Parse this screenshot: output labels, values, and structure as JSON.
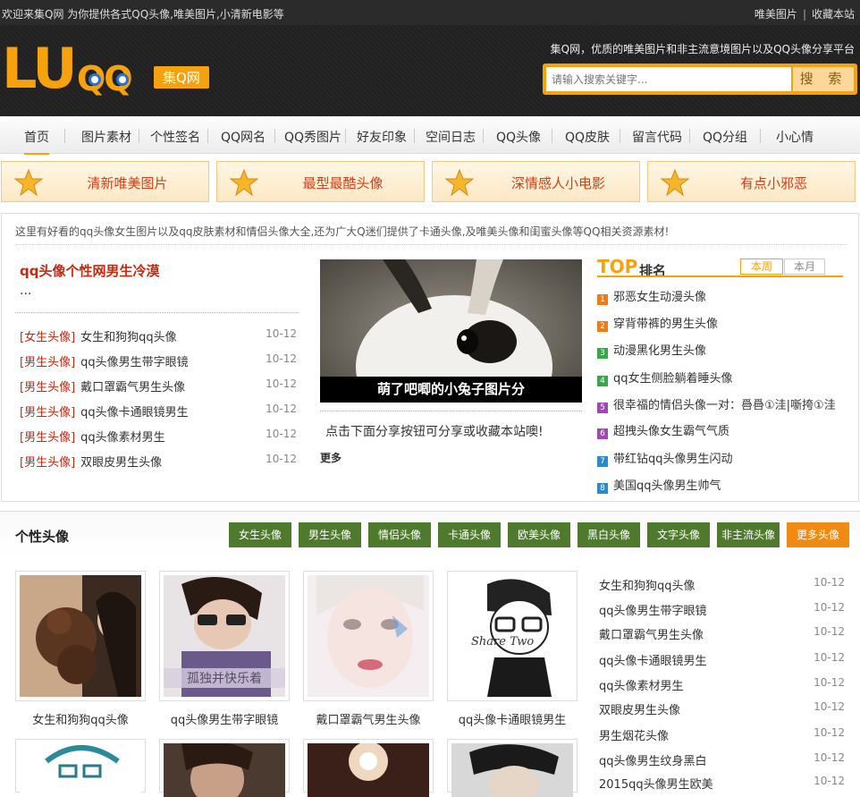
{
  "topbar": {
    "welcome": "欢迎来集Q网 为你提供各式QQ头像,唯美图片,小清新电影等",
    "link1": "唯美图片",
    "link2": "收藏本站"
  },
  "header": {
    "logo_text": "LU",
    "logo_qq": "QQ",
    "logo_badge": "集Q网",
    "slogan": "集Q网，优质的唯美图片和非主流意境图片以及QQ头像分享平台",
    "search_placeholder": "请输入搜索关键字...",
    "search_button": "搜 索"
  },
  "nav": [
    "首页",
    "图片素材",
    "个性签名",
    "QQ网名",
    "QQ秀图片",
    "好友印象",
    "空间日志",
    "QQ头像",
    "QQ皮肤",
    "留言代码",
    "QQ分组",
    "小心情"
  ],
  "features": [
    "清新唯美图片",
    "最型最酷头像",
    "深情感人小电影",
    "有点小邪恶"
  ],
  "intro": "这里有好看的qq头像女生图片以及qq皮肤素材和情侣头像大全,还为广大Q迷们提供了卡通头像,及唯美头像和闺蜜头像等QQ相关资源素材!",
  "headline": {
    "title": "qq头像个性网男生冷漠",
    "dots": "..."
  },
  "news": [
    {
      "cat": "[女生头像]",
      "title": "女生和狗狗qq头像",
      "date": "10-12"
    },
    {
      "cat": "[男生头像]",
      "title": "qq头像男生带字眼镜",
      "date": "10-12"
    },
    {
      "cat": "[男生头像]",
      "title": "戴口罩霸气男生头像",
      "date": "10-12"
    },
    {
      "cat": "[男生头像]",
      "title": "qq头像卡通眼镜男生",
      "date": "10-12"
    },
    {
      "cat": "[男生头像]",
      "title": "qq头像素材男生",
      "date": "10-12"
    },
    {
      "cat": "[男生头像]",
      "title": "双眼皮男生头像",
      "date": "10-12"
    }
  ],
  "photo": {
    "caption": "萌了吧唧的小兔子图片分",
    "share": "点击下面分享按钮可分享或收藏本站噢!",
    "more": "更多"
  },
  "top": {
    "title": "TOP",
    "subtitle": "排名",
    "tab_week": "本周",
    "tab_month": "本月",
    "items": [
      {
        "n": "1",
        "text": "邪恶女生动漫头像",
        "color": "#f07a14"
      },
      {
        "n": "2",
        "text": "穿背带裤的男生头像",
        "color": "#f07a14"
      },
      {
        "n": "3",
        "text": "动漫黑化男生头像",
        "color": "#3aa64a"
      },
      {
        "n": "4",
        "text": "qq女生侧脸躺着睡头像",
        "color": "#3aa64a"
      },
      {
        "n": "5",
        "text": "很幸福的情侣头像一对：噕噕①洼|噺挎①洼",
        "color": "#a04ab0"
      },
      {
        "n": "6",
        "text": "超拽头像女生霸气气质",
        "color": "#a04ab0"
      },
      {
        "n": "7",
        "text": "带红钻qq头像男生闪动",
        "color": "#2a8ad0"
      },
      {
        "n": "8",
        "text": "美国qq头像男生帅气",
        "color": "#2a8ad0"
      }
    ]
  },
  "section2": {
    "title": "个性头像",
    "tags": [
      "女生头像",
      "男生头像",
      "情侣头像",
      "卡通头像",
      "欧美头像",
      "黑白头像",
      "文字头像",
      "非主流头像",
      "更多头像"
    ],
    "thumbs": [
      "女生和狗狗qq头像",
      "qq头像男生带字眼镜",
      "戴口罩霸气男生头像",
      "qq头像卡通眼镜男生"
    ],
    "thumb2_overlay": "孤独并快乐着",
    "thumb4_text": "Share Two",
    "list": [
      {
        "title": "女生和狗狗qq头像",
        "date": "10-12"
      },
      {
        "title": "qq头像男生带字眼镜",
        "date": "10-12"
      },
      {
        "title": "戴口罩霸气男生头像",
        "date": "10-12"
      },
      {
        "title": "qq头像卡通眼镜男生",
        "date": "10-12"
      },
      {
        "title": "qq头像素材男生",
        "date": "10-12"
      },
      {
        "title": "双眼皮男生头像",
        "date": "10-12"
      },
      {
        "title": "男生烟花头像",
        "date": "10-12"
      },
      {
        "title": "qq头像男生纹身黑白",
        "date": "10-12"
      },
      {
        "title": "2015qq头像男生欧美",
        "date": "10-12"
      }
    ]
  },
  "colors": {
    "accent": "#f6a20e",
    "tag_green": "#4f7a2e",
    "tag_orange": "#f08a12",
    "red_text": "#c42a0e"
  }
}
